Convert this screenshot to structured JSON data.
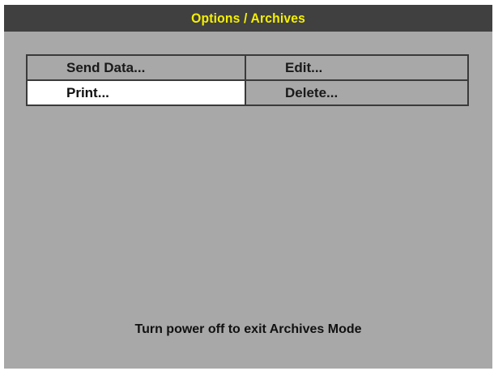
{
  "title": "Options / Archives",
  "colors": {
    "title_bar_bg": "#404040",
    "title_text": "#f5f000",
    "screen_bg": "#a8a8a8",
    "selected_bg": "#ffffff",
    "border": "#3a3a3a"
  },
  "menu": {
    "items": [
      {
        "label": "Send Data...",
        "selected": false
      },
      {
        "label": "Edit...",
        "selected": false
      },
      {
        "label": "Print...",
        "selected": true
      },
      {
        "label": "Delete...",
        "selected": false
      }
    ]
  },
  "status": {
    "message": "Turn power off to exit Archives Mode"
  }
}
